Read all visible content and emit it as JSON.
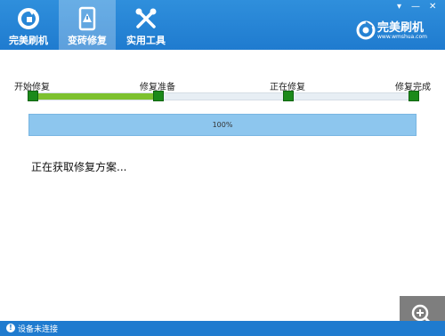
{
  "app": {
    "nav": [
      {
        "label": "完美刷机",
        "icon": "flash-app-icon",
        "active": false
      },
      {
        "label": "变砖修复",
        "icon": "warning-phone-icon",
        "active": true
      },
      {
        "label": "实用工具",
        "icon": "tools-icon",
        "active": false
      }
    ],
    "window_controls": {
      "menu": "▾",
      "minimize": "—",
      "close": "✕"
    },
    "brand": {
      "name": "完美刷机",
      "url": "www.wmshua.com"
    }
  },
  "steps": [
    {
      "label": "开始修复"
    },
    {
      "label": "修复准备"
    },
    {
      "label": "正在修复"
    },
    {
      "label": "修复完成"
    }
  ],
  "step_progress_fraction": 0.333,
  "progress": {
    "text": "100%",
    "value": 100
  },
  "status_message": "正在获取修复方案...",
  "statusbar": {
    "text": "设备未连接",
    "warn_glyph": "!"
  },
  "colors": {
    "accent": "#1f7bcf",
    "progress_fill": "#8dc6ee",
    "track_done": "#7dc12f",
    "step_marker": "#1c8a1a"
  }
}
